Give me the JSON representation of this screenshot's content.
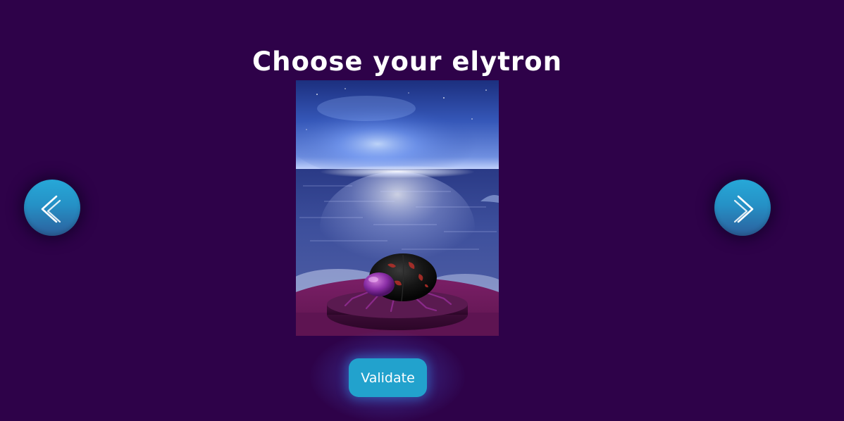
{
  "header": {
    "title": "Choose your elytron"
  },
  "carousel": {
    "prev_icon": "chevron-left-icon",
    "next_icon": "chevron-right-icon",
    "preview_subject": "elytron-beetle-preview"
  },
  "actions": {
    "validate_label": "Validate"
  },
  "colors": {
    "background": "#2e0249",
    "accent": "#22a2cd",
    "title_text": "#ffffff"
  }
}
